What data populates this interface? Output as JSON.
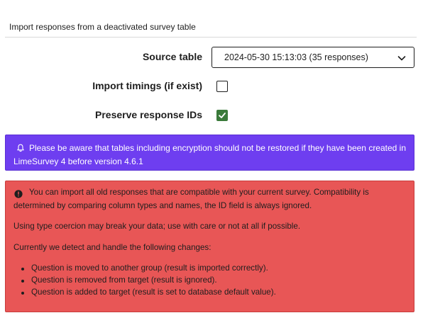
{
  "panel": {
    "title": "Import responses from a deactivated survey table"
  },
  "form": {
    "source_table_label": "Source table",
    "source_table_value": "2024-05-30 15:13:03 (35 responses)",
    "import_timings_label": "Import timings (if exist)",
    "import_timings_checked": false,
    "preserve_ids_label": "Preserve response IDs",
    "preserve_ids_checked": true
  },
  "info_alert": {
    "icon": "bell-icon",
    "line1": "Please be aware that tables including encryption should not be restored if they have been created in",
    "line2": "LimeSurvey 4 before version 4.6.1",
    "color": "#6e3ef0"
  },
  "danger_alert": {
    "icon": "exclamation-circle-icon",
    "para1_line1": "You can import all old responses that are compatible with your current survey. Compatibility is",
    "para1_line2": "determined by comparing column types and names, the ID field is always ignored.",
    "para2": "Using type coercion may break your data; use with care or not at all if possible.",
    "para3": "Currently we detect and handle the following changes:",
    "items": [
      "Question is moved to another group (result is imported correctly).",
      "Question is removed from target (result is ignored).",
      "Question is added to target (result is set to database default value)."
    ],
    "color": "#e85656"
  }
}
